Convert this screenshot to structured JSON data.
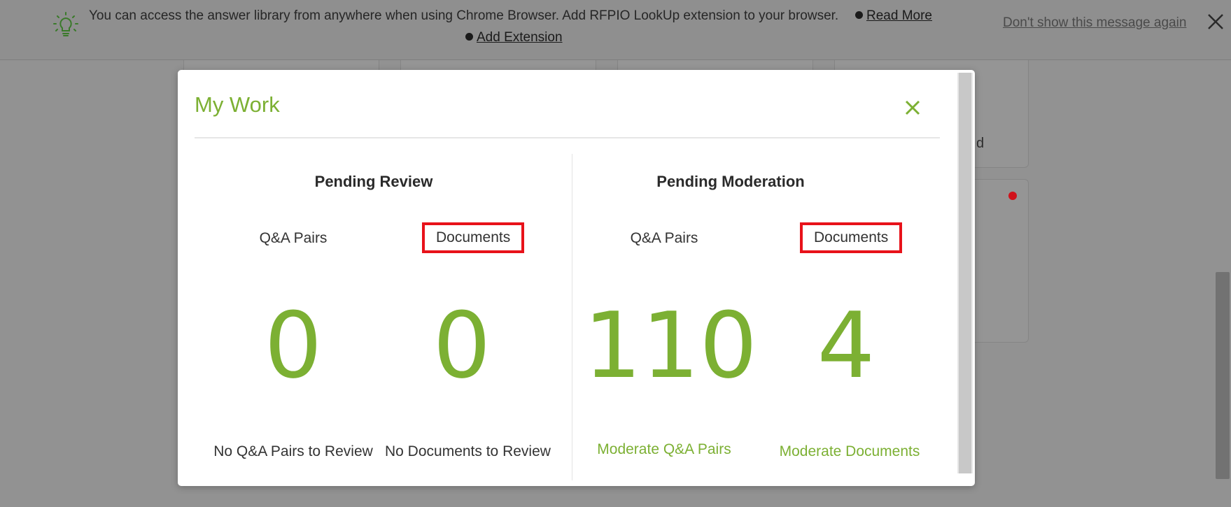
{
  "banner": {
    "message": "You can access the answer library from anywhere when using Chrome Browser. Add RFPIO LookUp extension to your browser.",
    "read_more": "Read More",
    "add_extension": "Add Extension",
    "dont_show": "Don't show this message again",
    "icon": "lightbulb-icon",
    "close_icon": "close-icon"
  },
  "background": {
    "fragment_text": "d",
    "dot_color": "#d0121b"
  },
  "modal": {
    "title": "My Work",
    "close_icon": "close-icon",
    "accent_color": "#7cb033",
    "pending_review": {
      "title": "Pending Review",
      "qa_label": "Q&A Pairs",
      "doc_label": "Documents",
      "qa_count": "0",
      "doc_count": "0",
      "qa_status": "No Q&A Pairs to Review",
      "doc_status": "No Documents to Review"
    },
    "pending_moderation": {
      "title": "Pending Moderation",
      "qa_label": "Q&A Pairs",
      "doc_label": "Documents",
      "qa_count": "110",
      "doc_count": "4",
      "qa_action": "Moderate Q&A Pairs",
      "doc_action": "Moderate Documents"
    }
  }
}
